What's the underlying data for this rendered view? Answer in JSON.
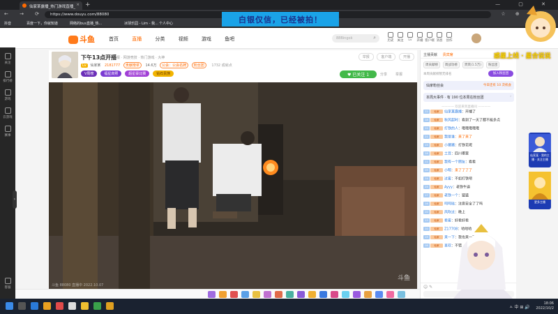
{
  "browser": {
    "tab_title": "仙家某露播_热门游戏直播_",
    "tab_close": "×",
    "new_tab": "+",
    "window_controls": "— ▢ ✕",
    "nav": "← → ⟳ ⌂",
    "url": "https://www.douyu.com/88080",
    "toolbar_right": "☆ ⊕ ✚ ⋮",
    "bookmarks": [
      "抖音",
      "百度一下，你就知道",
      "网络的bus直播_热...",
      "冰球乐园 - Lim - 我...",
      "个人中心"
    ]
  },
  "overlay_banner": "白银仅信，已经被拍！",
  "site": {
    "logo": "斗鱼",
    "nav": [
      "首页",
      "直播",
      "分类",
      "视频",
      "游戏",
      "鱼吧"
    ],
    "nav_active_index": 1,
    "search_placeholder": "88Bingok",
    "search_icon": "⌕",
    "header_icons": [
      "历史",
      "关注",
      "Lv",
      "开播",
      "客户端",
      "消息",
      "创作"
    ]
  },
  "left_sidebar": {
    "items": [
      "关注",
      "排行榜",
      "游戏",
      "云游戏",
      "赛事"
    ],
    "bottom_item": "客服",
    "toggle": "›"
  },
  "room": {
    "title": "下午13点开播",
    "category": "举报 · 网游竞技 · 热门游戏 · 大神",
    "host_level": "Lv",
    "host_name": "仙家某",
    "hot_value": "2181777",
    "tag1": "贡献榜单",
    "fans_count": "14.6万",
    "tag2": "公会：公会名牌",
    "tag3": "粉丝团",
    "live_time": "1732 成就点",
    "badges": [
      "V周榜",
      "福星高照",
      "超星豪比赛",
      "钻石贵族"
    ],
    "header_buttons": [
      "举报",
      "客户端",
      "开播"
    ],
    "follow_button": "♥ 已关注",
    "follow_count": "1",
    "share": "分享",
    "report": "举报"
  },
  "video": {
    "watermark": "斗鱼",
    "bottom_text": "斗鱼 88080  直播中  2022.10.07"
  },
  "chat": {
    "tabs": [
      "主播贡献",
      "贵宾席",
      "周榜",
      "粉丝",
      "粉丝团"
    ],
    "tabs_active": "贵宾席",
    "rank_tabs": [
      "周贡献榜",
      "周战功榜",
      "贵宾(1.5万)",
      "粉丝团"
    ],
    "rank_note": "本周贡献榜暂无排名",
    "join_button": "加入粉丝团",
    "fans_name": "仙家粉丝会",
    "fans_right": "今日还有 10 次机会",
    "event_text": "本周大事件 · 有 190 位本周在粉丝团",
    "event_right": "›",
    "divider": "———— 欢迎来到直播间 ————",
    "messages": [
      {
        "lv": "22",
        "fan": "仙家",
        "name": "仙家某露播",
        "text": "：开播了",
        "hl": false
      },
      {
        "lv": "18",
        "fan": "仙家",
        "name": "秋风起时",
        "text": "：看到了一天了都不能多点",
        "hl": false
      },
      {
        "lv": "12",
        "fan": "仙家",
        "name": "打铁的人",
        "text": "：哦哦哦哦哦",
        "hl": false
      },
      {
        "lv": "21",
        "fan": "仙家",
        "name": "我是谁",
        "text": "：来了来了",
        "hl": true
      },
      {
        "lv": "15",
        "fan": "仙家",
        "name": "小猪猪",
        "text": "：打铁花呢",
        "hl": false
      },
      {
        "lv": "28",
        "fan": "仙家",
        "name": "土豆",
        "text": "：四川哪里",
        "hl": false
      },
      {
        "lv": "11",
        "fan": "仙家",
        "name": "我有一个朋友",
        "text": "：看看",
        "hl": false
      },
      {
        "lv": "09",
        "fan": "仙家",
        "name": "小明",
        "text": "：来了了了了",
        "hl": true
      },
      {
        "lv": "14",
        "fan": "仙家",
        "name": "过客",
        "text": "：不如打铁吧",
        "hl": false
      },
      {
        "lv": "25",
        "fan": "仙家",
        "name": "Ayyy",
        "text": "：老铁牛逼",
        "hl": false
      },
      {
        "lv": "17",
        "fan": "仙家",
        "name": "老铁一个",
        "text": "：猛猛",
        "hl": false
      },
      {
        "lv": "16",
        "fan": "仙家",
        "name": "呵呵哒",
        "text": "：注意安全了了吗",
        "hl": false
      },
      {
        "lv": "20",
        "fan": "仙家",
        "name": "风吹过",
        "text": "：晚上",
        "hl": false
      },
      {
        "lv": "13",
        "fan": "仙家",
        "name": "看客",
        "text": "：好看好看",
        "hl": false
      },
      {
        "lv": "10",
        "fan": "仙家",
        "name": "Z17708",
        "text": "：哈哈哈",
        "hl": false
      },
      {
        "lv": "19",
        "fan": "仙家",
        "name": "来一下",
        "text": "：我也来一下",
        "hl": false
      },
      {
        "lv": "08",
        "fan": "仙家",
        "name": "喜欢",
        "text": "：不错",
        "hl": false
      }
    ],
    "input_icons": "☺ ✎"
  },
  "promo": {
    "title": "惑星上线 · 星合说说",
    "card1": "仙家某 · 我的主播 · 关注主播",
    "card2": "更多主播"
  },
  "taskbar": {
    "time": "18:06",
    "date": "2022/10/2",
    "sys": "ㅅ 中 ⊞ 🔊"
  },
  "colors": {
    "accent": "#ff6a00",
    "follow_green": "#43b94a",
    "banner_blue": "#1aa3e8",
    "badge_purple": "#7b3ad3"
  }
}
